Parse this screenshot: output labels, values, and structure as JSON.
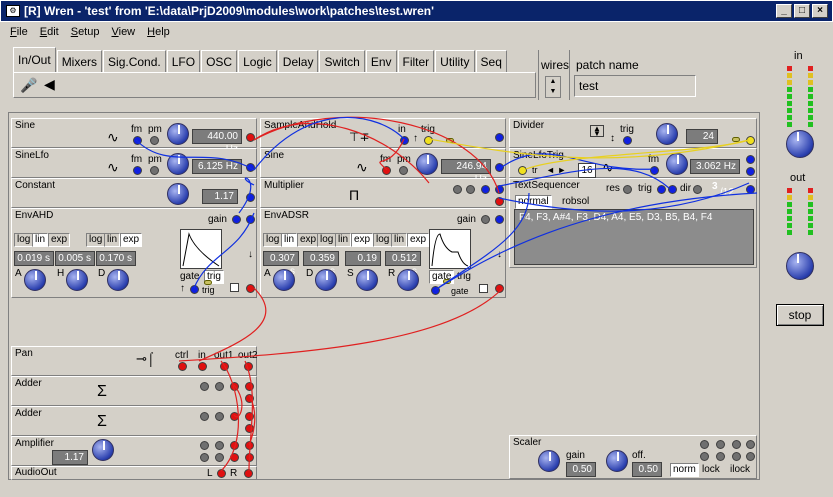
{
  "window": {
    "title": "[R]  Wren - 'test' from 'E:\\data\\PrjD2009\\modules\\work\\patches\\test.wren'"
  },
  "menu": [
    "File",
    "Edit",
    "Setup",
    "View",
    "Help"
  ],
  "tabs": [
    "In/Out",
    "Mixers",
    "Sig.Cond.",
    "LFO",
    "OSC",
    "Logic",
    "Delay",
    "Switch",
    "Env",
    "Filter",
    "Utility",
    "Seq"
  ],
  "wires_label": "wires",
  "patch_name_label": "patch name",
  "patch_name_value": "test",
  "side": {
    "in_label": "in",
    "out_label": "out",
    "stop_label": "stop"
  },
  "modules": {
    "sine": {
      "name": "Sine",
      "fm": "fm",
      "pm": "pm",
      "freq": "440.00 Hz"
    },
    "sinelfo": {
      "name": "SineLfo",
      "fm": "fm",
      "pm": "pm",
      "freq": "6.125 Hz"
    },
    "constant": {
      "name": "Constant",
      "value": "1.17"
    },
    "envahd": {
      "name": "EnvAHD",
      "gain": "gain",
      "log1": "log",
      "lin1": "lin",
      "exp1": "exp",
      "log2": "log",
      "lin2": "lin",
      "exp2": "exp",
      "a": "0.019 s",
      "h": "0.005 s",
      "d": "0.170 s",
      "ka": "A",
      "kh": "H",
      "kd": "D",
      "gate": "gate",
      "trig": "trig",
      "trig2": "trig"
    },
    "samplehold": {
      "name": "SampleAndHold",
      "in": "in",
      "trig": "trig"
    },
    "sine2": {
      "name": "Sine",
      "fm": "fm",
      "pm": "pm",
      "freq": "246.94 Hz"
    },
    "multiplier": {
      "name": "Multiplier",
      "symbol": "Π"
    },
    "envadsr": {
      "name": "EnvADSR",
      "gain": "gain",
      "log1": "log",
      "lin1": "lin",
      "exp1": "exp",
      "log2": "log",
      "lin2": "lin",
      "exp2": "exp",
      "log3": "log",
      "lin3": "lin",
      "exp3": "exp",
      "a": "0.307 s",
      "d": "0.359 s",
      "s": "0.19",
      "r": "0.512 s",
      "ka": "A",
      "kd": "D",
      "ks": "S",
      "kr": "R",
      "gate": "gate",
      "trig": "trig",
      "gate2": "gate"
    },
    "divider": {
      "name": "Divider",
      "trig": "trig",
      "value": "24"
    },
    "sinelfotrig": {
      "name": "SineLfoTrig",
      "trig": "tr",
      "fm": "fm",
      "freq": "3.062 Hz",
      "steps": "16"
    },
    "textseq": {
      "name": "TextSequencer",
      "res": "res",
      "trig": "trig",
      "dir": "dir",
      "mode1": "normal",
      "mode2": "robsol",
      "step": "3",
      "total": "/12",
      "text": "F4, F3, A#4, F3, D4, A4, E5, D3, B5, B4, F4"
    },
    "pan": {
      "name": "Pan",
      "ctrl": "ctrl",
      "in": "in",
      "out1": "out1",
      "out2": "out2"
    },
    "adder1": {
      "name": "Adder",
      "symbol": "Σ"
    },
    "adder2": {
      "name": "Adder",
      "symbol": "Σ"
    },
    "amplifier": {
      "name": "Amplifier",
      "value": "1.17"
    },
    "audioout": {
      "name": "AudioOut",
      "l": "L",
      "r": "R"
    },
    "scaler": {
      "name": "Scaler",
      "gain": "gain",
      "gain_value": "0.50",
      "off": "off.",
      "off_value": "0.50",
      "norm": "norm",
      "lock": "lock",
      "ilock": "ilock"
    }
  }
}
